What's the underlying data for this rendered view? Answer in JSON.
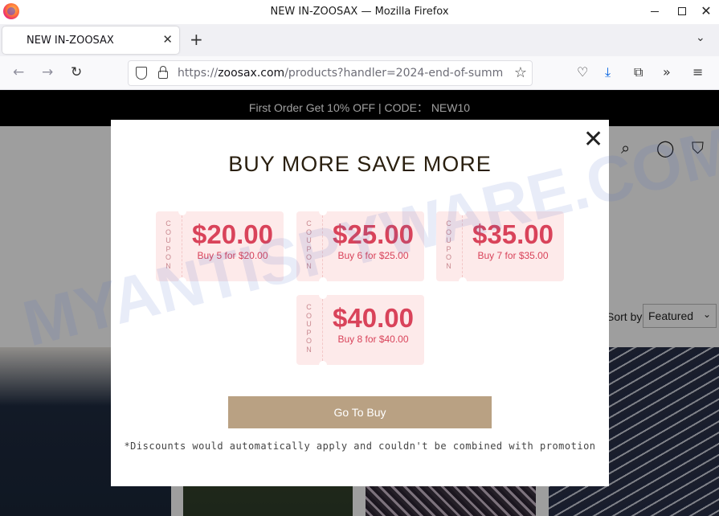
{
  "window": {
    "title": "NEW IN-ZOOSAX — Mozilla Firefox"
  },
  "tabs": [
    {
      "label": "NEW IN-ZOOSAX"
    }
  ],
  "url": {
    "prefix": "https://",
    "domain": "zoosax.com",
    "path": "/products?handler=2024-end-of-summ"
  },
  "page": {
    "announcement": "First Order Get 10% OFF | CODE： NEW10",
    "sort_label": "Sort by",
    "sort_value": "Featured"
  },
  "modal": {
    "title": "BUY MORE SAVE MORE",
    "coupon_word": "COUPON",
    "coupons": [
      {
        "amount": "$20.00",
        "desc": "Buy 5 for $20.00"
      },
      {
        "amount": "$25.00",
        "desc": "Buy 6 for $25.00"
      },
      {
        "amount": "$35.00",
        "desc": "Buy 7 for $35.00"
      },
      {
        "amount": "$40.00",
        "desc": "Buy 8 for $40.00"
      }
    ],
    "button": "Go To Buy",
    "disclaimer": "*Discounts would automatically apply and couldn't be combined with promotion"
  },
  "watermark": "MYANTISPYWARE.COM",
  "colors": {
    "accent": "#b9a183",
    "coupon_text": "#d9435a",
    "coupon_bg": "#fdeaea"
  }
}
